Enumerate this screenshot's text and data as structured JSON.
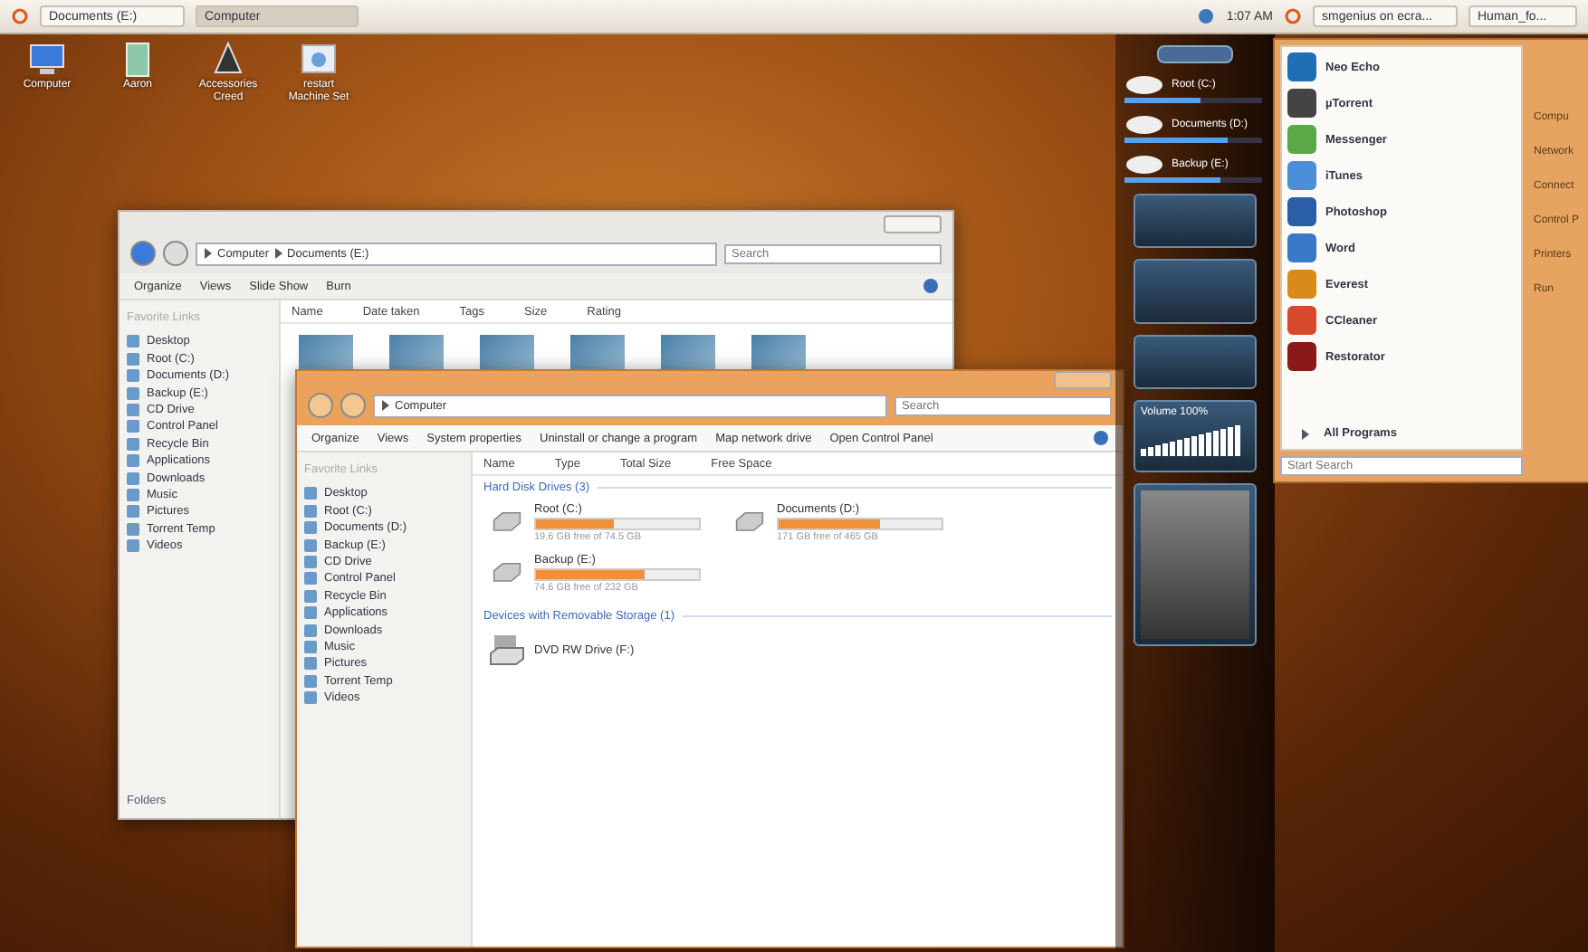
{
  "top_panel": {
    "left_tasks": [
      {
        "label": "Documents (E:)",
        "selected": false
      },
      {
        "label": "Computer",
        "selected": true
      }
    ],
    "clock": "1:07 AM",
    "right_tasks": [
      {
        "label": "smgenius on ecra...",
        "selected": false
      },
      {
        "label": "Human_fo...",
        "selected": false
      }
    ]
  },
  "desktop_icons": [
    {
      "label": "Computer",
      "kind": "computer"
    },
    {
      "label": "Aaron",
      "kind": "user"
    },
    {
      "label": "Accessories Creed",
      "kind": "app"
    },
    {
      "label": "restart Machine Set",
      "kind": "restart"
    }
  ],
  "back_window": {
    "address": [
      "Computer",
      "Documents (E:)"
    ],
    "search": {
      "placeholder": "Search"
    },
    "toolbar": [
      "Organize",
      "Views",
      "Slide Show",
      "Burn"
    ],
    "sidebar": {
      "heading": "Favorite Links",
      "items": [
        "Desktop",
        "Root (C:)",
        "Documents (D:)",
        "Backup (E:)",
        "CD Drive",
        "Control Panel",
        "Recycle Bin",
        "Applications",
        "Downloads",
        "Music",
        "Pictures",
        "Torrent Temp",
        "Videos"
      ],
      "footer": "Folders"
    },
    "columns": [
      "Name",
      "Date taken",
      "Tags",
      "Size",
      "Rating"
    ]
  },
  "front_window": {
    "address": [
      "Computer"
    ],
    "search": {
      "placeholder": "Search"
    },
    "toolbar": [
      "Organize",
      "Views",
      "System properties",
      "Uninstall or change a program",
      "Map network drive",
      "Open Control Panel"
    ],
    "sidebar": {
      "heading": "Favorite Links",
      "items": [
        "Desktop",
        "Root (C:)",
        "Documents (D:)",
        "Backup (E:)",
        "CD Drive",
        "Control Panel",
        "Recycle Bin",
        "Applications",
        "Downloads",
        "Music",
        "Pictures",
        "Torrent Temp",
        "Videos"
      ]
    },
    "columns": [
      "Name",
      "Type",
      "Total Size",
      "Free Space"
    ],
    "groups": [
      {
        "title": "Hard Disk Drives (3)",
        "items": [
          {
            "kind": "disk",
            "name": "Root (C:)",
            "level": 0.48,
            "detail": "19.6 GB free of 74.5 GB"
          },
          {
            "kind": "disk",
            "name": "Documents (D:)",
            "level": 0.62,
            "detail": "171 GB free of 465 GB"
          },
          {
            "kind": "disk",
            "name": "Backup (E:)",
            "level": 0.67,
            "detail": "74.6 GB free of 232 GB"
          }
        ]
      },
      {
        "title": "Devices with Removable Storage (1)",
        "items": [
          {
            "kind": "dvd",
            "name": "DVD RW Drive (F:)"
          }
        ]
      }
    ]
  },
  "gadgets": {
    "drives": [
      {
        "name": "Root (C:)",
        "level": 0.55
      },
      {
        "name": "Documents (D:)",
        "level": 0.75
      },
      {
        "name": "Backup (E:)",
        "level": 0.7
      }
    ],
    "volume": {
      "label": "Volume 100%",
      "level": 1
    }
  },
  "start_menu": {
    "programs": [
      {
        "label": "Neo Echo",
        "color": "#1f6fb5"
      },
      {
        "label": "µTorrent",
        "color": "#444444"
      },
      {
        "label": "Messenger",
        "color": "#5aa848"
      },
      {
        "label": "iTunes",
        "color": "#4a8fd8"
      },
      {
        "label": "Photoshop",
        "color": "#2a5fa8"
      },
      {
        "label": "Word",
        "color": "#3a78c8"
      },
      {
        "label": "Everest",
        "color": "#d88a1a"
      },
      {
        "label": "CCleaner",
        "color": "#d8482a"
      },
      {
        "label": "Restorator",
        "color": "#8a1a1a"
      }
    ],
    "all_programs": "All Programs",
    "search": {
      "placeholder": "Start Search"
    },
    "places": [
      "Compu",
      "Network",
      "Connect",
      "Control P",
      "Printers",
      "Run"
    ]
  }
}
